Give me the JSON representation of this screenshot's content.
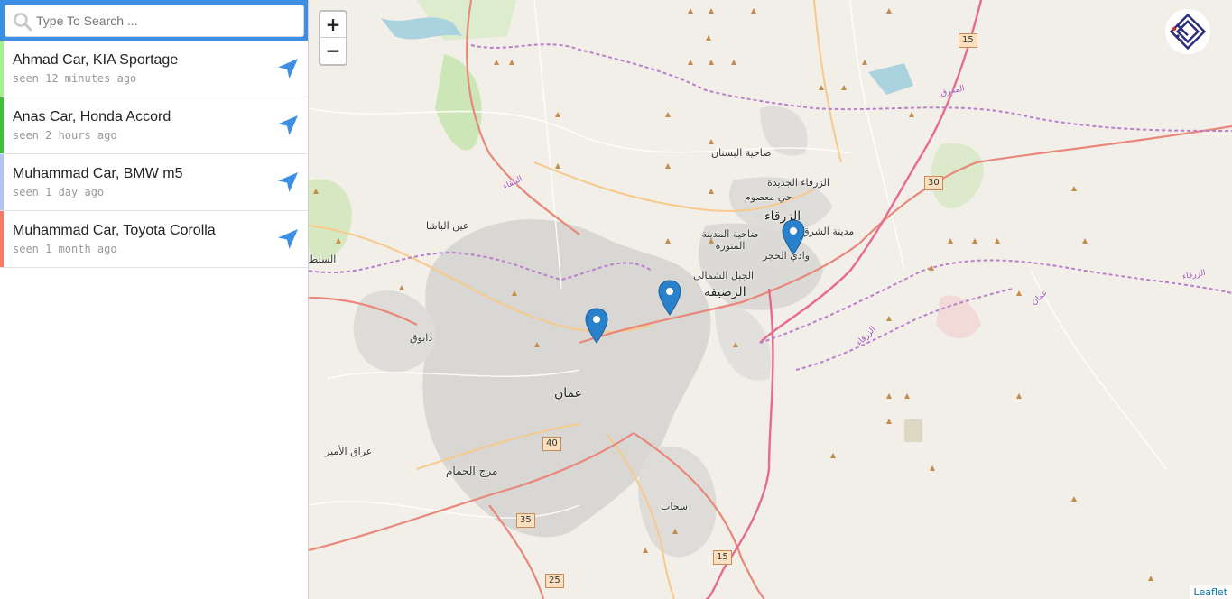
{
  "search": {
    "placeholder": "Type To Search ..."
  },
  "vehicles": [
    {
      "name": "Ahmad Car, KIA Sportage",
      "seen": "seen 12 minutes ago",
      "color": "#a9ef8d"
    },
    {
      "name": "Anas Car, Honda Accord",
      "seen": "seen 2 hours ago",
      "color": "#3fc23b"
    },
    {
      "name": "Muhammad Car, BMW m5",
      "seen": "seen 1 day ago",
      "color": "#b3c4f1"
    },
    {
      "name": "Muhammad Car, Toyota Corolla",
      "seen": "seen 1 month ago",
      "color": "#f47a6c"
    }
  ],
  "map": {
    "zoom_in": "+",
    "zoom_out": "−",
    "attribution": "Leaflet",
    "labels": {
      "amman": "عمان",
      "zarqa": "الزرقاء",
      "russeifa": "الرصيفة",
      "marj_alhamam": "مرج الحمام",
      "sahab": "سحاب",
      "ain_albasha": "عين الباشا",
      "dabouq": "دابوق",
      "iraq_alamir": "عراق الأمير",
      "dahiyat_albustan": "ضاحية البستان",
      "zarqa_new": "الزرقاء الجديدة",
      "hay_masoum": "حي معصوم",
      "madinat_munawara": "ضاحية المدينة المنورة",
      "jabal_shamali": "الجبل الشمالي",
      "madinat_sharq": "مدينة الشرق",
      "wadi_hajar": "وادي الحجر",
      "salt": "السلط",
      "road_mafraq": "المفرق",
      "road_balqa": "البلقاء",
      "road_zarqa_1": "الزرقاء",
      "road_zarqa_2": "الزرقاء",
      "road_amman": "عمان"
    },
    "shields": {
      "r15a": "15",
      "r30": "30",
      "r40": "40",
      "r35": "35",
      "r25": "25",
      "r15b": "15"
    },
    "accent_color": "#3d8fe6",
    "marker_color": "#2a81cb"
  }
}
